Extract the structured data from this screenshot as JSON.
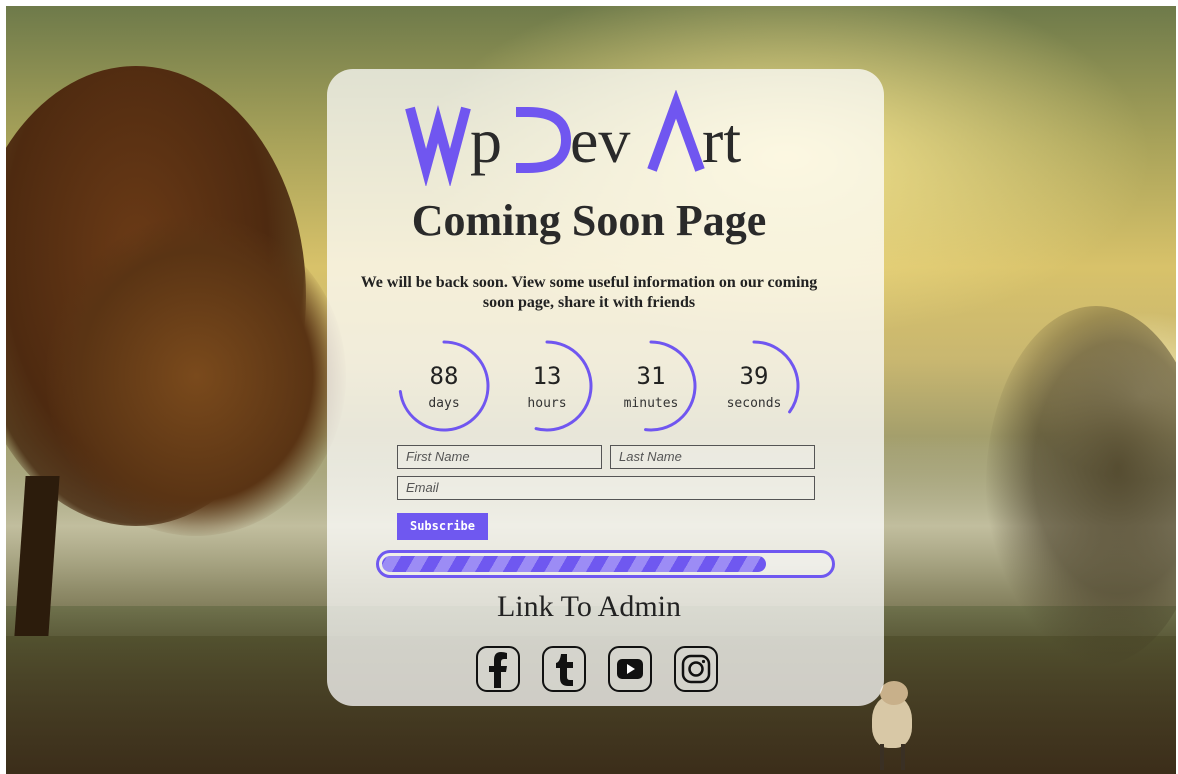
{
  "logo": {
    "text": "WpDevArt",
    "accent_color": "#7056f0"
  },
  "page": {
    "title": "Coming Soon Page",
    "description_line1": "We will be back soon. View some useful information on our coming",
    "description_line2": "soon page, share it with friends"
  },
  "countdown": [
    {
      "value": "88",
      "label": "days",
      "fraction": 0.73
    },
    {
      "value": "13",
      "label": "hours",
      "fraction": 0.54
    },
    {
      "value": "31",
      "label": "minutes",
      "fraction": 0.52
    },
    {
      "value": "39",
      "label": "seconds",
      "fraction": 0.35
    }
  ],
  "form": {
    "first_name_placeholder": "First Name",
    "last_name_placeholder": "Last Name",
    "email_placeholder": "Email",
    "subscribe_label": "Subscribe"
  },
  "progress": {
    "percent": 86,
    "color": "#6f58f0"
  },
  "admin_link": "Link To Admin",
  "socials": [
    {
      "name": "facebook-icon"
    },
    {
      "name": "tumblr-icon"
    },
    {
      "name": "youtube-icon"
    },
    {
      "name": "instagram-icon"
    }
  ]
}
